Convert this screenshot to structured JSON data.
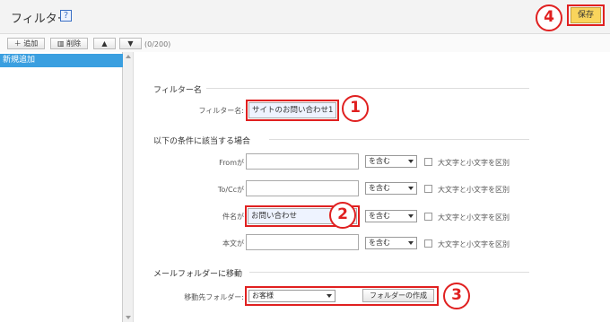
{
  "header": {
    "title": "フィルター",
    "help_icon": "?",
    "save_label": "保存"
  },
  "toolbar": {
    "add_label": "追加",
    "delete_label": "削除",
    "count": "(0/200)"
  },
  "sidebar": {
    "items": [
      {
        "label": "新規追加"
      }
    ]
  },
  "sections": {
    "name": {
      "heading": "フィルター名",
      "label": "フィルター名:",
      "value": "サイトのお問い合わせ1"
    },
    "conditions": {
      "heading": "以下の条件に該当する場合",
      "rows": [
        {
          "label": "Fromが",
          "value": "",
          "operator": "を含む",
          "case_label": "大文字と小文字を区別"
        },
        {
          "label": "To/Ccが",
          "value": "",
          "operator": "を含む",
          "case_label": "大文字と小文字を区別"
        },
        {
          "label": "件名が",
          "value": "お問い合わせ",
          "operator": "を含む",
          "case_label": "大文字と小文字を区別"
        },
        {
          "label": "本文が",
          "value": "",
          "operator": "を含む",
          "case_label": "大文字と小文字を区別"
        }
      ]
    },
    "move": {
      "heading": "メールフォルダーに移動",
      "label": "移動先フォルダー:",
      "folder": "お客様",
      "create_label": "フォルダーの作成"
    }
  },
  "annotations": [
    "1",
    "2",
    "3",
    "4"
  ],
  "colors": {
    "accent": "#e02020",
    "selected": "#3a9fe0",
    "save": "#f9d45c"
  }
}
